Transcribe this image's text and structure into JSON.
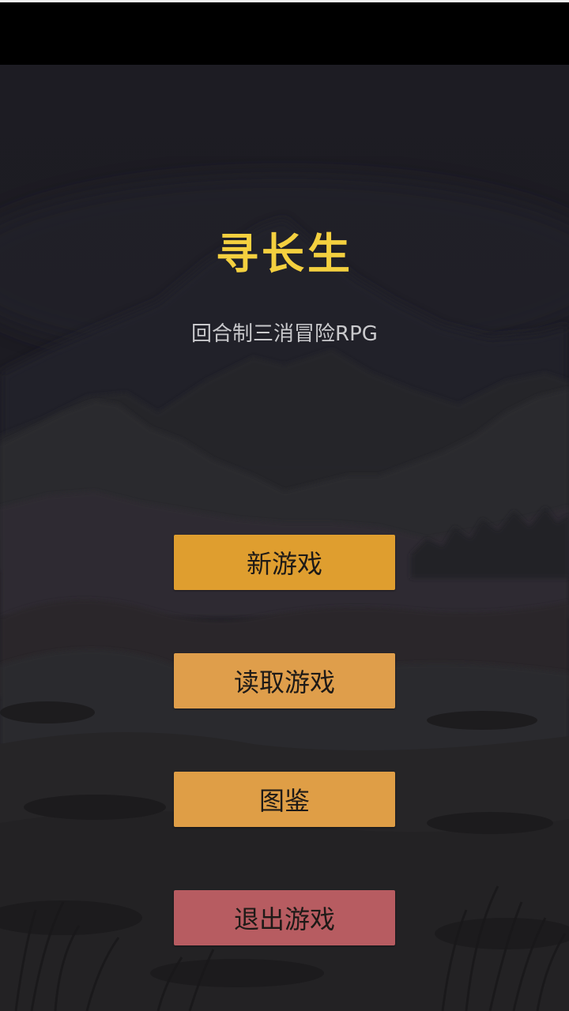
{
  "game": {
    "title": "寻长生",
    "subtitle": "回合制三消冒险RPG"
  },
  "menu": {
    "new_game": "新游戏",
    "load_game": "读取游戏",
    "gallery": "图鉴",
    "exit_game": "退出游戏"
  },
  "colors": {
    "title": "#f4d03f",
    "button_primary": "#df9e2f",
    "button_secondary": "#df9e4b",
    "button_exit": "#b75c61",
    "background": "#1d1c23"
  }
}
